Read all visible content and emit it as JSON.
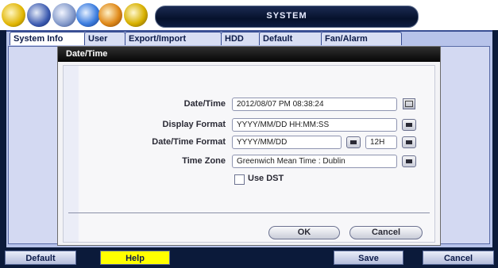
{
  "window": {
    "title": "SYSTEM"
  },
  "toolbar": {
    "icons": [
      "settings-gear-icon",
      "camera-icon",
      "schedule-icon",
      "network-icon",
      "search-icon",
      "log-icon"
    ]
  },
  "tabs": [
    {
      "label": "System Info"
    },
    {
      "label": "User"
    },
    {
      "label": "Export/Import"
    },
    {
      "label": "HDD"
    },
    {
      "label": "Default"
    },
    {
      "label": "Fan/Alarm"
    }
  ],
  "dialog": {
    "title": "Date/Time",
    "fields": {
      "datetime": {
        "label": "Date/Time",
        "value": "2012/08/07 PM 08:38:24"
      },
      "display_format": {
        "label": "Display Format",
        "value": "YYYY/MM/DD HH:MM:SS"
      },
      "datetime_format": {
        "label": "Date/Time Format",
        "value": "YYYY/MM/DD",
        "hour_value": "12H"
      },
      "time_zone": {
        "label": "Time Zone",
        "value": "Greenwich Mean Time : Dublin"
      }
    },
    "use_dst": {
      "label": "Use DST",
      "checked": false
    },
    "buttons": {
      "ok": "OK",
      "cancel": "Cancel"
    }
  },
  "bottom_bar": {
    "default": "Default",
    "help": "Help",
    "save": "Save",
    "cancel": "Cancel"
  },
  "colors": {
    "help_button": "#ffff00",
    "background": "#0b1a3a",
    "panel": "#b7c3ea"
  }
}
